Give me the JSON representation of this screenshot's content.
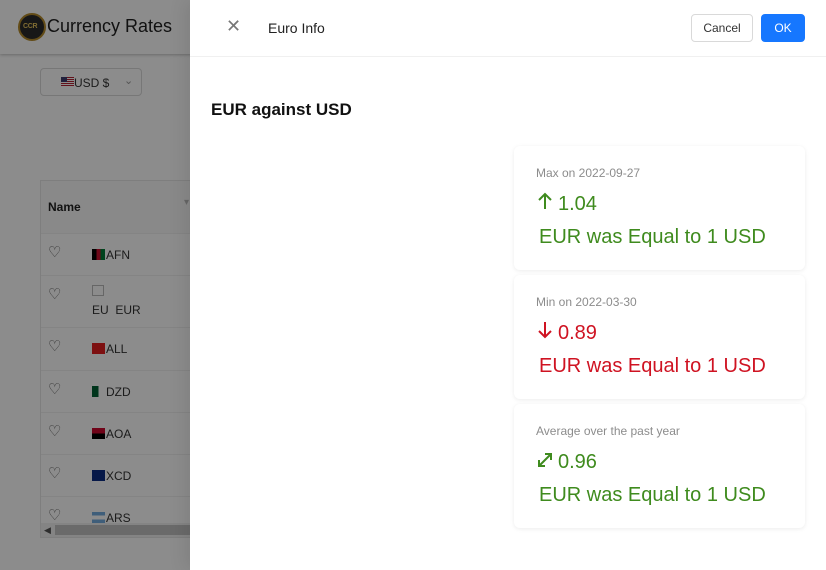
{
  "app": {
    "title": "Currency Rates",
    "logo_text": "CCR",
    "currency_select": {
      "value": "USD $",
      "flag": "us-flag-icon"
    }
  },
  "table": {
    "column_name": "Name",
    "rows": [
      {
        "code": "AFN",
        "flag_colors": [
          "#000000",
          "#c8102e",
          "#007a36"
        ]
      },
      {
        "code": "EUR",
        "broken_alt": "EU",
        "flag_colors": []
      },
      {
        "code": "ALL",
        "flag_colors": [
          "#e41e20",
          "#e41e20",
          "#000000"
        ]
      },
      {
        "code": "DZD",
        "flag_colors": [
          "#006233",
          "#ffffff",
          "#d21034"
        ]
      },
      {
        "code": "AOA",
        "flag_colors": [
          "#cc092f",
          "#000000",
          "#f9d616"
        ]
      },
      {
        "code": "XCD",
        "flag_colors": [
          "#0c2d83",
          "#ffffff",
          "#d00c27"
        ]
      },
      {
        "code": "ARS",
        "flag_colors": [
          "#74acdf",
          "#ffffff",
          "#74acdf"
        ]
      }
    ]
  },
  "drawer": {
    "title": "Euro Info",
    "cancel_label": "Cancel",
    "ok_label": "OK",
    "heading": "EUR against USD",
    "cards": [
      {
        "label": "Max on 2022-09-27",
        "value": "1.04",
        "icon": "arrow-up-icon",
        "desc": "EUR was Equal to 1 USD",
        "color": "#3f8b1e"
      },
      {
        "label": "Min on 2022-03-30",
        "value": "0.89",
        "icon": "arrow-down-icon",
        "desc": "EUR was Equal to 1 USD",
        "color": "#cf1322"
      },
      {
        "label": "Average over the past year",
        "value": "0.96",
        "icon": "expand-arrows-icon",
        "desc": "EUR was Equal to 1 USD",
        "color": "#3f8b1e"
      }
    ]
  }
}
